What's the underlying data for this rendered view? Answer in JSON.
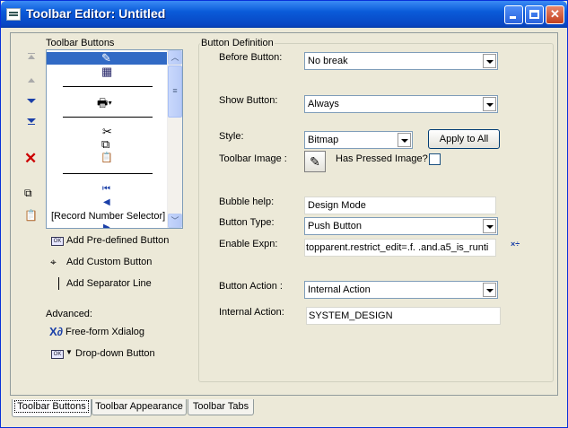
{
  "window": {
    "title": "Toolbar Editor: Untitled"
  },
  "left": {
    "list_title": "Toolbar Buttons",
    "list_last_item": "[Record Number Selector]",
    "add_predefined": "Add Pre-defined Button",
    "add_custom": "Add Custom Button",
    "add_separator": "Add Separator Line",
    "advanced_label": "Advanced:",
    "freeform": "Free-form Xdialog",
    "dropdown": "Drop-down Button",
    "ok_badge": "OK"
  },
  "definition": {
    "group_title": "Button Definition",
    "before_button_label": "Before Button:",
    "before_button_value": "No break",
    "show_button_label": "Show Button:",
    "show_button_value": "Always",
    "style_label": "Style:",
    "style_value": "Bitmap",
    "apply_to_all": "Apply to All",
    "toolbar_image_label": "Toolbar Image :",
    "has_pressed_label": "Has Pressed Image?",
    "has_pressed_checked": false,
    "bubble_help_label": "Bubble help:",
    "bubble_help_value": "Design Mode",
    "button_type_label": "Button Type:",
    "button_type_value": "Push Button",
    "enable_expn_label": "Enable Expn:",
    "enable_expn_value": "topparent.restrict_edit=.f. .and.a5_is_runti",
    "button_action_label": "Button Action :",
    "button_action_value": "Internal Action",
    "internal_action_label": "Internal Action:",
    "internal_action_value": "SYSTEM_DESIGN"
  },
  "tabs": [
    "Toolbar Buttons",
    "Toolbar Appearance",
    "Toolbar Tabs"
  ]
}
